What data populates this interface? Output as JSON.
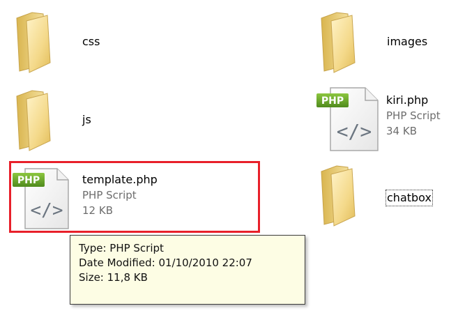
{
  "items": {
    "css": {
      "name": "css",
      "icon": "folder-icon"
    },
    "images": {
      "name": "images",
      "icon": "folder-icon"
    },
    "js": {
      "name": "js",
      "icon": "folder-icon"
    },
    "kiri": {
      "name": "kiri.php",
      "type": "PHP Script",
      "size": "34 KB",
      "icon": "php-file-icon",
      "badge": "PHP"
    },
    "template": {
      "name": "template.php",
      "type": "PHP Script",
      "size": "12 KB",
      "icon": "php-file-icon",
      "badge": "PHP"
    },
    "chatbox": {
      "name": "chatbox",
      "icon": "folder-icon"
    }
  },
  "tooltip": {
    "type": "Type: PHP Script",
    "date_modified": "Date Modified: 01/10/2010 22:07",
    "size": "Size: 11,8 KB"
  },
  "colors": {
    "selection_border": "#e8202a",
    "tooltip_bg": "#fdfde4",
    "php_badge": "#6aa22a",
    "folder": "#f0d27a"
  }
}
